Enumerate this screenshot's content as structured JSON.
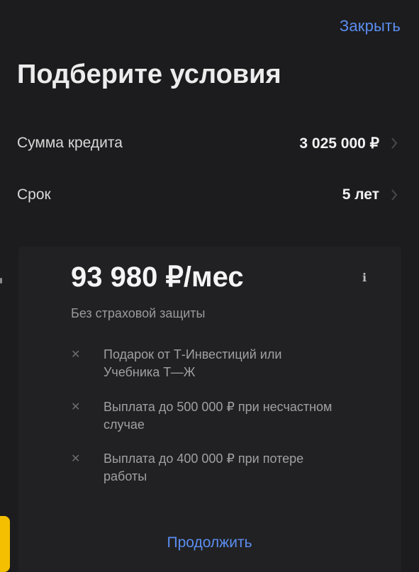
{
  "header": {
    "close_label": "Закрыть"
  },
  "page": {
    "title": "Подберите условия"
  },
  "fields": [
    {
      "label": "Сумма кредита",
      "value": "3 025 000 ₽"
    },
    {
      "label": "Срок",
      "value": "5 лет"
    }
  ],
  "offer": {
    "price": "93 980 ₽/мес",
    "info_icon": "ℹ",
    "subtitle": "Без страховой защиты",
    "features": [
      {
        "icon": "✕",
        "text_line1": "Подарок от Т-Инвестиций или",
        "text_line2": "Учебника Т—Ж"
      },
      {
        "icon": "✕",
        "text_line1": "Выплата до 500 000 ₽ при несчастном",
        "text_line2": "случае"
      },
      {
        "icon": "✕",
        "text_line1": "Выплата до 400 000 ₽ при потере",
        "text_line2": "работы"
      }
    ],
    "continue_label": "Продолжить"
  },
  "colors": {
    "accent": "#5b8def",
    "background": "#1c1c1e",
    "card": "#212123",
    "tab": "#f4bf00"
  }
}
